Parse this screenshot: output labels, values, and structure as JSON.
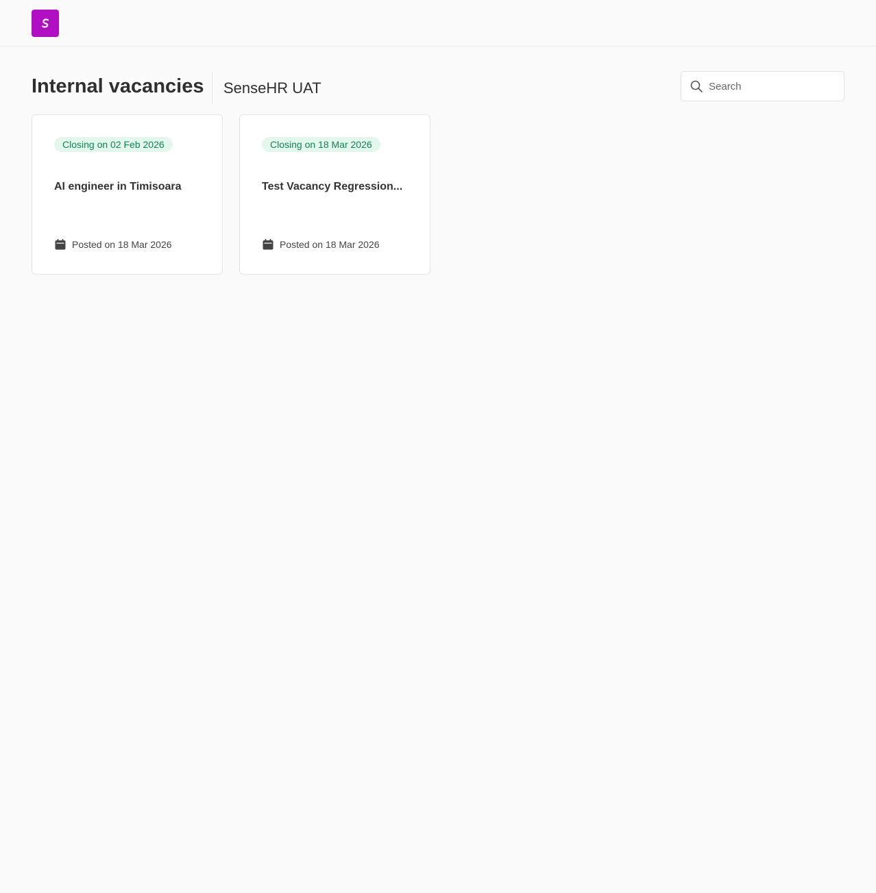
{
  "header": {
    "logo_alt": "SenseHR logo"
  },
  "page": {
    "title": "Internal vacancies",
    "company": "SenseHR UAT"
  },
  "search": {
    "placeholder": "Search",
    "value": ""
  },
  "vacancies": [
    {
      "closing": "Closing on 02 Feb 2026",
      "title": "AI engineer in Timisoara",
      "posted": "Posted on 18 Mar 2026"
    },
    {
      "closing": "Closing on 18 Mar 2026",
      "title": "Test Vacancy Regression...",
      "posted": "Posted on 18 Mar 2026"
    }
  ],
  "colors": {
    "brand": "#b00fc4",
    "badge_bg": "#e3f7ec",
    "badge_text": "#12845a",
    "background": "#fafafa"
  },
  "icons": {
    "logo": "sensehr-logo-icon",
    "search": "search-icon",
    "date": "calendar-icon"
  }
}
